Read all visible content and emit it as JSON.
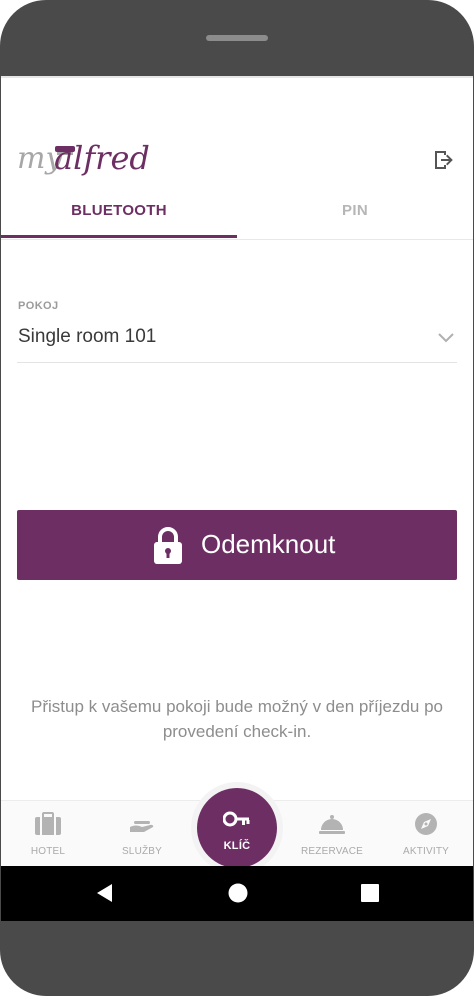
{
  "app": {
    "logo_text": "myalfred",
    "logo_color": "#6d2f63",
    "logo_gray": "#a7a7a7"
  },
  "header": {
    "logout_icon": "logout-icon"
  },
  "tabs": [
    {
      "label": "BLUETOOTH",
      "active": true
    },
    {
      "label": "PIN",
      "active": false
    }
  ],
  "room_field": {
    "label": "POKOJ",
    "value": "Single room 101",
    "icon": "chevron-down-icon"
  },
  "unlock_button": {
    "label": "Odemknout",
    "icon": "lock-icon",
    "color": "#6d2f63"
  },
  "info_text": "Přistup k vašemu pokoji bude možný v den příjezdu po provedení check-in.",
  "bottom_nav": [
    {
      "label": "HOTEL",
      "icon": "suitcase-icon"
    },
    {
      "label": "SLUŽBY",
      "icon": "hand-tray-icon"
    },
    {
      "label": "KLÍČ",
      "icon": "key-icon",
      "active": true
    },
    {
      "label": "REZERVACE",
      "icon": "cloche-icon"
    },
    {
      "label": "AKTIVITY",
      "icon": "compass-icon"
    }
  ],
  "system_nav": [
    "back-icon",
    "home-icon",
    "recents-icon"
  ],
  "colors": {
    "accent": "#6d2f63",
    "inactive": "#b6b6b6"
  }
}
